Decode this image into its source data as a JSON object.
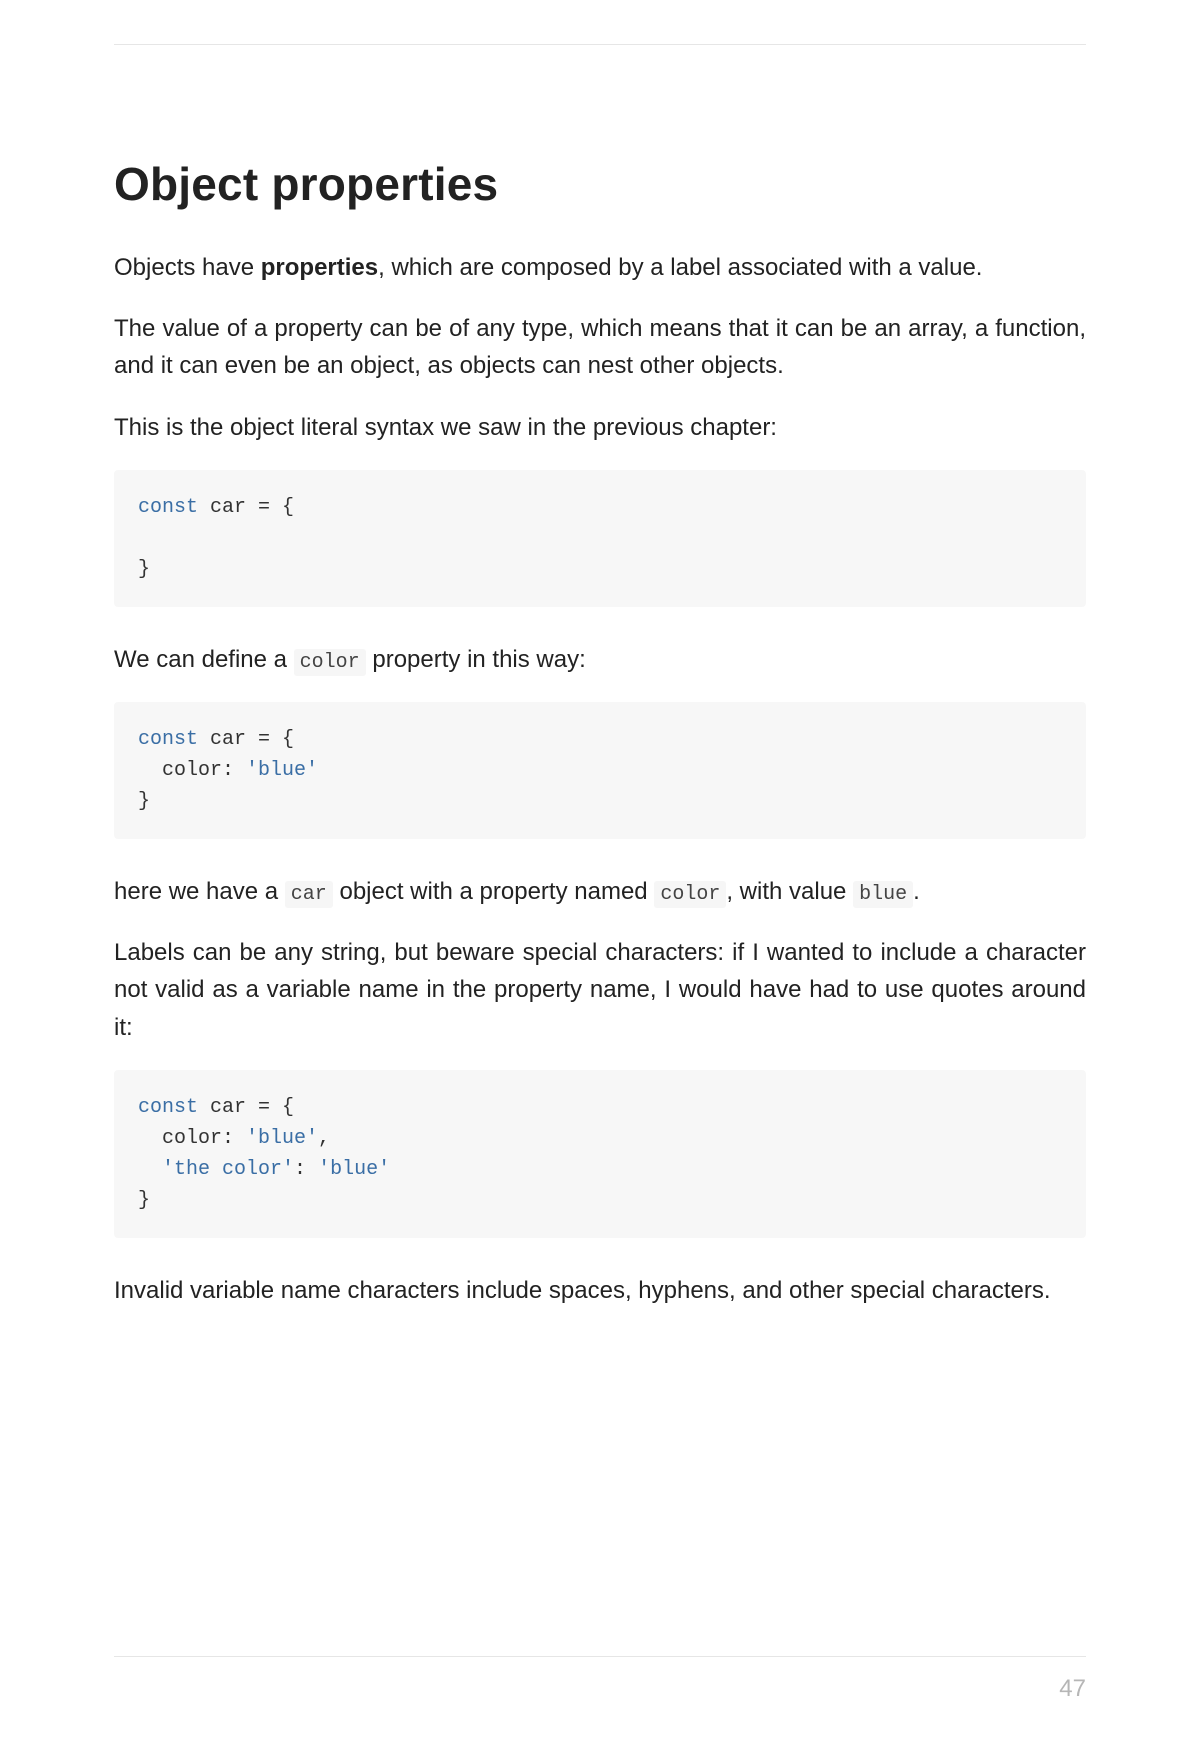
{
  "heading": "Object properties",
  "para1_a": "Objects have ",
  "para1_b": "properties",
  "para1_c": ", which are composed by a label associated with a value.",
  "para2": "The value of a property can be of any type, which means that it can be an array, a function, and it can even be an object, as objects can nest other objects.",
  "para3": "This is the object literal syntax we saw in the previous chapter:",
  "code1": {
    "l1_kw": "const",
    "l1_rest": " car = {",
    "l2_blank": "",
    "l3": "}"
  },
  "para4_a": "We can define a ",
  "para4_code": "color",
  "para4_b": " property in this way:",
  "code2": {
    "l1_kw": "const",
    "l1_rest": " car = {",
    "l2_a": "  color: ",
    "l2_str": "'blue'",
    "l3": "}"
  },
  "para5_a": "here we have a ",
  "para5_code1": "car",
  "para5_b": " object with a property named ",
  "para5_code2": "color",
  "para5_c": ", with value ",
  "para5_code3": "blue",
  "para5_d": ".",
  "para6": "Labels can be any string, but beware special characters: if I wanted to include a character not valid as a variable name in the property name, I would have had to use quotes around it:",
  "code3": {
    "l1_kw": "const",
    "l1_rest": " car = {",
    "l2_a": "  color: ",
    "l2_str": "'blue'",
    "l2_b": ",",
    "l3_a": "  ",
    "l3_str1": "'the color'",
    "l3_b": ": ",
    "l3_str2": "'blue'",
    "l4": "}"
  },
  "para7": "Invalid variable name characters include spaces, hyphens, and other special characters.",
  "page_number": "47"
}
